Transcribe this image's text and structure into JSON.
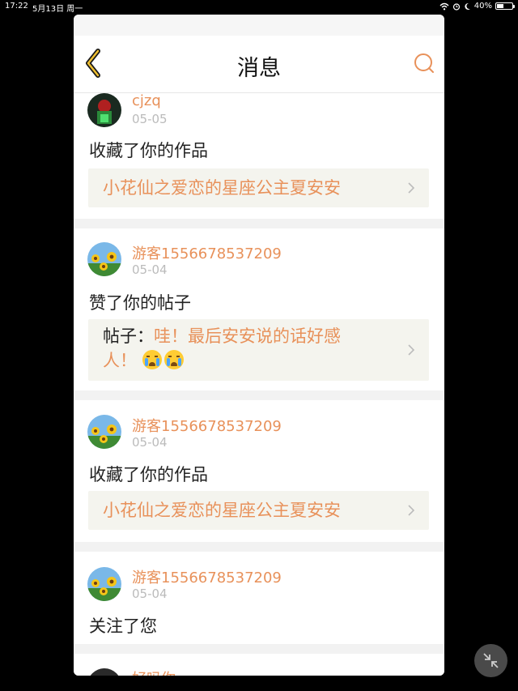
{
  "status": {
    "time": "17:22",
    "date": "5月13日 周一",
    "battery": "40%"
  },
  "nav": {
    "title": "消息"
  },
  "messages": [
    {
      "user": "cjzq",
      "date": "05-05",
      "action": "收藏了你的作品",
      "ref_text": "小花仙之爱恋的星座公主夏安安",
      "avatar": "avatar-red"
    },
    {
      "user": "游客1556678537209",
      "date": "05-04",
      "action": "赞了你的帖子",
      "ref_prefix": "帖子：",
      "ref_line1": "哇！最后安安说的话好感",
      "ref_line2": "人！",
      "avatar": "avatar-sunflower"
    },
    {
      "user": "游客1556678537209",
      "date": "05-04",
      "action": "收藏了你的作品",
      "ref_text": "小花仙之爱恋的星座公主夏安安",
      "avatar": "avatar-sunflower"
    },
    {
      "user": "游客1556678537209",
      "date": "05-04",
      "action": "关注了您",
      "avatar": "avatar-sunflower"
    },
    {
      "user": "好吗你",
      "avatar": "avatar-car"
    }
  ],
  "colors": {
    "accent": "#e8915a",
    "card_bg": "#ffffff",
    "ref_bg": "#f4f4ee",
    "page_bg": "#f2f2f2"
  }
}
